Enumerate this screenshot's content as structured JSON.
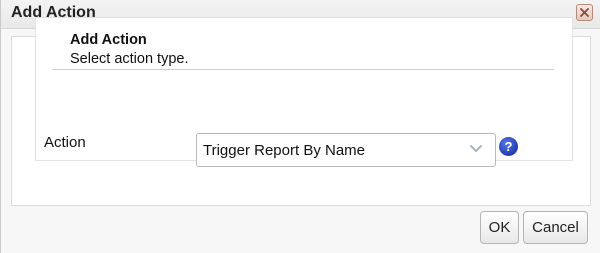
{
  "dialog": {
    "title": "Add Action",
    "close_icon": "close-icon"
  },
  "header": {
    "title": "Add Action",
    "subtitle": "Select action type."
  },
  "form": {
    "action_label": "Action",
    "action_value": "Trigger Report By Name",
    "help_icon": "help-icon",
    "help_glyph": "?"
  },
  "footer": {
    "ok_label": "OK",
    "cancel_label": "Cancel"
  },
  "colors": {
    "help_icon_blue": "#1f3ea8",
    "close_button_tint": "#e5c8bd"
  }
}
